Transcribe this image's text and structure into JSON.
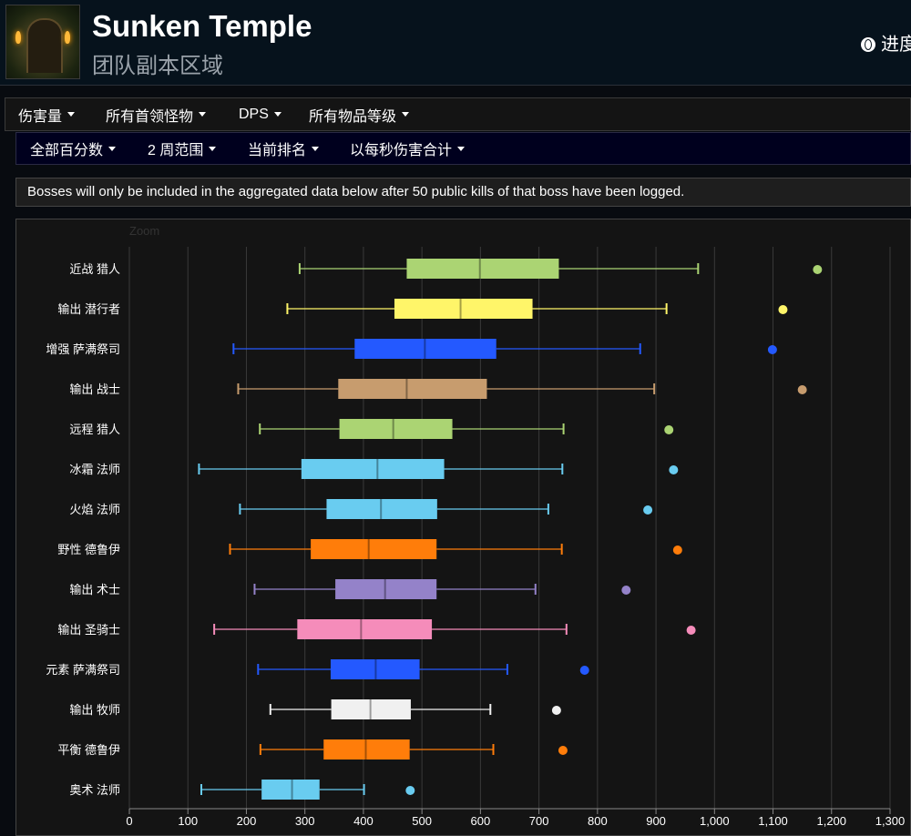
{
  "header": {
    "title": "Sunken Temple",
    "subtitle": "团队副本区域",
    "progress_link": "进度"
  },
  "filters_primary": [
    {
      "label": "伤害量"
    },
    {
      "label": "所有首领怪物"
    },
    {
      "label": "DPS"
    },
    {
      "label": "所有物品等级"
    }
  ],
  "filters_secondary": [
    {
      "label": "全部百分数"
    },
    {
      "label": "2 周范围"
    },
    {
      "label": "当前排名"
    },
    {
      "label": "以每秒伤害合计"
    }
  ],
  "notice": "Bosses will only be included in the aggregated data below after 50 public kills of that boss have been logged.",
  "chart": {
    "zoom_label": "Zoom"
  },
  "chart_data": {
    "type": "boxplot",
    "orientation": "horizontal",
    "x_range": [
      0,
      1300
    ],
    "x_ticks": [
      0,
      100,
      200,
      300,
      400,
      500,
      600,
      700,
      800,
      900,
      1000,
      1100,
      1200,
      1300
    ],
    "x_tick_labels": [
      "0",
      "100",
      "200",
      "300",
      "400",
      "500",
      "600",
      "700",
      "800",
      "900",
      "1,000",
      "1,100",
      "1,200",
      "1,300"
    ],
    "grid": true,
    "series": [
      {
        "name": "近战 猎人",
        "color": "#abd473",
        "min": 291,
        "q1": 474,
        "median": 599,
        "q3": 734,
        "max": 972,
        "outlier": 1176
      },
      {
        "name": "输出 潜行者",
        "color": "#fff569",
        "min": 270,
        "q1": 453,
        "median": 566,
        "q3": 689,
        "max": 918,
        "outlier": 1117
      },
      {
        "name": "增强 萨满祭司",
        "color": "#2459ff",
        "min": 178,
        "q1": 385,
        "median": 505,
        "q3": 627,
        "max": 873,
        "outlier": 1099
      },
      {
        "name": "输出 战士",
        "color": "#c79c6e",
        "min": 186,
        "q1": 357,
        "median": 474,
        "q3": 611,
        "max": 897,
        "outlier": 1150
      },
      {
        "name": "远程 猎人",
        "color": "#abd473",
        "min": 223,
        "q1": 359,
        "median": 451,
        "q3": 552,
        "max": 742,
        "outlier": 922
      },
      {
        "name": "冰霜 法师",
        "color": "#69ccf0",
        "min": 119,
        "q1": 294,
        "median": 424,
        "q3": 538,
        "max": 740,
        "outlier": 930
      },
      {
        "name": "火焰 法师",
        "color": "#69ccf0",
        "min": 189,
        "q1": 337,
        "median": 430,
        "q3": 526,
        "max": 716,
        "outlier": 886
      },
      {
        "name": "野性 德鲁伊",
        "color": "#ff7d0a",
        "min": 172,
        "q1": 310,
        "median": 409,
        "q3": 525,
        "max": 739,
        "outlier": 937
      },
      {
        "name": "输出 术士",
        "color": "#9482c9",
        "min": 214,
        "q1": 352,
        "median": 437,
        "q3": 525,
        "max": 694,
        "outlier": 849
      },
      {
        "name": "输出 圣骑士",
        "color": "#f58cba",
        "min": 145,
        "q1": 287,
        "median": 396,
        "q3": 517,
        "max": 747,
        "outlier": 960
      },
      {
        "name": "元素 萨满祭司",
        "color": "#2459ff",
        "min": 220,
        "q1": 344,
        "median": 421,
        "q3": 496,
        "max": 646,
        "outlier": 778
      },
      {
        "name": "输出 牧师",
        "color": "#f0f0f0",
        "min": 241,
        "q1": 345,
        "median": 412,
        "q3": 481,
        "max": 617,
        "outlier": 730
      },
      {
        "name": "平衡 德鲁伊",
        "color": "#ff7d0a",
        "min": 224,
        "q1": 332,
        "median": 404,
        "q3": 479,
        "max": 622,
        "outlier": 741
      },
      {
        "name": "奥术 法师",
        "color": "#69ccf0",
        "min": 123,
        "q1": 226,
        "median": 278,
        "q3": 325,
        "max": 401,
        "outlier": 480
      }
    ]
  }
}
